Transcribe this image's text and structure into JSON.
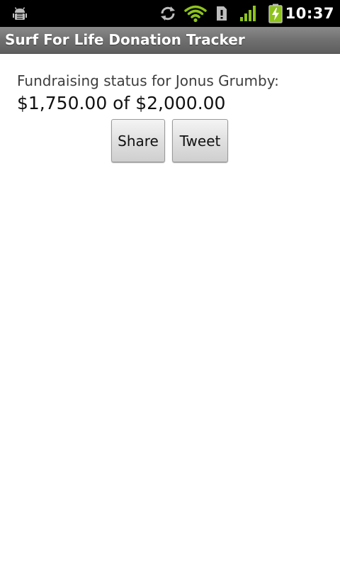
{
  "status_bar": {
    "time": "10:37",
    "icons": [
      "android-debug-icon",
      "sync-icon",
      "wifi-icon",
      "sim-card-icon",
      "signal-icon",
      "battery-charging-icon"
    ]
  },
  "title_bar": {
    "title": "Surf For Life Donation Tracker"
  },
  "main": {
    "status_label": "Fundraising status for Jonus Grumby:",
    "amount_text": "$1,750.00 of $2,000.00",
    "share_label": "Share",
    "tweet_label": "Tweet"
  },
  "colors": {
    "status_bar_bg": "#000000",
    "title_bar_bg": "#6f6f6f",
    "icon_green": "#8ec31c"
  }
}
